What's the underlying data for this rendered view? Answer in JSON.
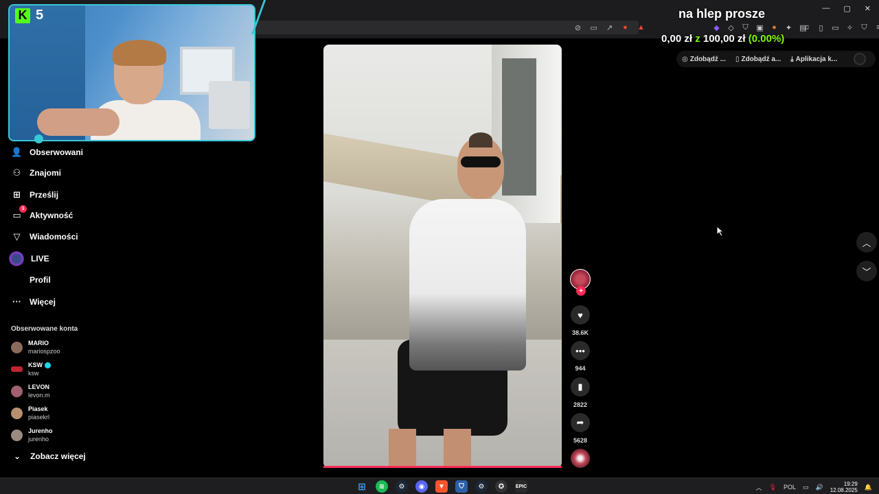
{
  "stream_overlay": {
    "logo_letter": "K",
    "viewer_count": "5",
    "goal_title": "na hlep prosze",
    "goal_current": "0,00 zł",
    "goal_sep": "z",
    "goal_target": "100,00 zł",
    "goal_percent": "(0.00%)"
  },
  "bookmarks": [
    {
      "label": "Zdobądź ...",
      "icon": "spiral-icon"
    },
    {
      "label": "Zdobądź a...",
      "icon": "phone-icon"
    },
    {
      "label": "Aplikacja k...",
      "icon": "download-icon"
    }
  ],
  "sidebar": {
    "items": [
      {
        "label": "Obserwowani",
        "icon": "person-plus-icon"
      },
      {
        "label": "Znajomi",
        "icon": "people-icon"
      },
      {
        "label": "Prześlij",
        "icon": "plus-box-icon"
      },
      {
        "label": "Aktywność",
        "icon": "message-icon",
        "badge": "3"
      },
      {
        "label": "Wiadomości",
        "icon": "send-icon"
      },
      {
        "label": "LIVE",
        "icon": "live-icon"
      },
      {
        "label": "Profil",
        "icon": "profile-icon"
      },
      {
        "label": "Więcej",
        "icon": "more-icon"
      }
    ],
    "followed_title": "Obserwowane konta",
    "accounts": [
      {
        "name": "MARIO",
        "handle": "mariospzoo"
      },
      {
        "name": "KSW",
        "handle": "ksw",
        "verified": true
      },
      {
        "name": "LEVON",
        "handle": "levon.m"
      },
      {
        "name": "Piasek",
        "handle": "piasekrl"
      },
      {
        "name": "Jurenho",
        "handle": "jurenho"
      }
    ],
    "see_more": "Zobacz więcej"
  },
  "video_actions": {
    "likes": "38.6K",
    "comments": "944",
    "saves": "2822",
    "shares": "5628"
  },
  "taskbar": {
    "lang": "POL",
    "time": "19:29",
    "date": "12.08.2025"
  },
  "colors": {
    "accent": "#fe2c55",
    "kick_green": "#53fc18",
    "cam_border": "#38c7d6",
    "goal_green": "#7CFC00"
  }
}
